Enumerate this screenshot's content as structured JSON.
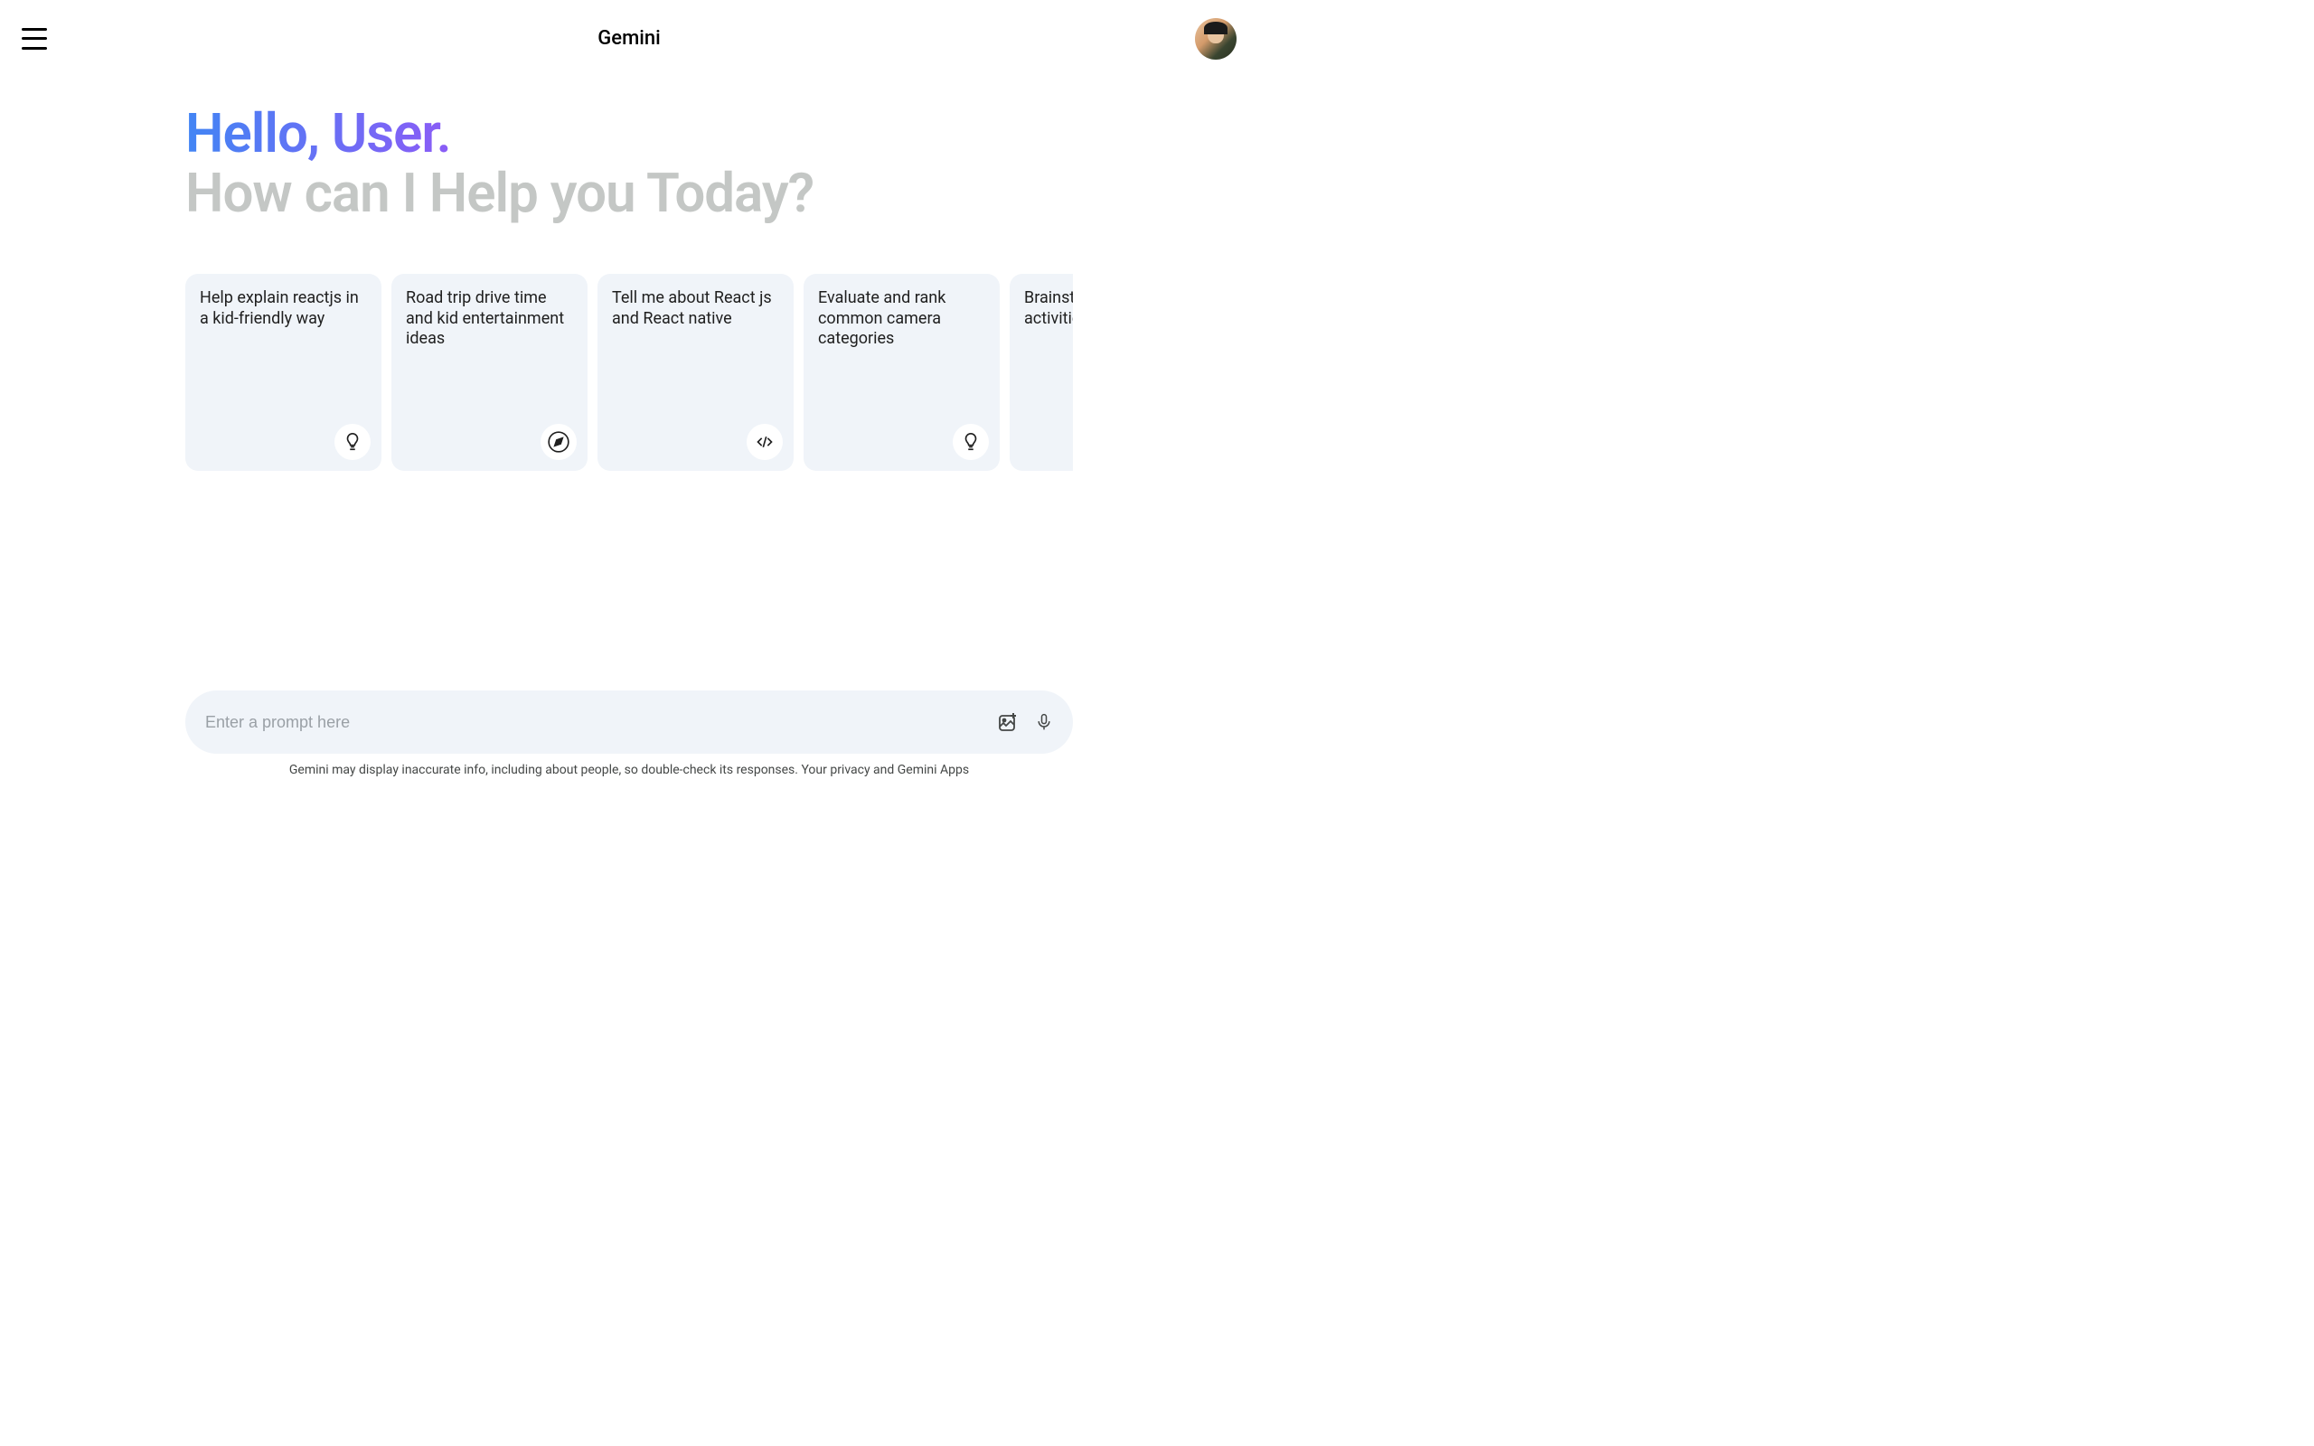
{
  "header": {
    "title": "Gemini"
  },
  "greeting": {
    "hello": "Hello, User.",
    "subheading": "How can I Help you Today?"
  },
  "cards": [
    {
      "text": "Help explain reactjs in a kid-friendly way",
      "icon": "lightbulb"
    },
    {
      "text": "Road trip drive time and kid entertainment ideas",
      "icon": "compass"
    },
    {
      "text": "Tell me about React js and React native",
      "icon": "code"
    },
    {
      "text": "Evaluate and rank common camera categories",
      "icon": "lightbulb"
    },
    {
      "text": "Brainstorm bonding activities for our work",
      "icon": "lightbulb"
    }
  ],
  "input": {
    "placeholder": "Enter a prompt here"
  },
  "disclaimer": "Gemini may display inaccurate info, including about people, so double-check its responses. Your privacy and Gemini Apps"
}
